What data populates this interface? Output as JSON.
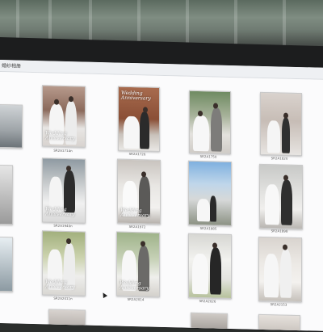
{
  "window": {
    "title": "婚纱相册"
  },
  "files": [
    {
      "name": "SR2A1714n"
    },
    {
      "name": "SR2A1726"
    },
    {
      "name": "SR2A1750"
    },
    {
      "name": "SR2A1820"
    },
    {
      "name": "SR2A1940n"
    },
    {
      "name": "SR2A1972"
    },
    {
      "name": "SR2A1985"
    },
    {
      "name": "SR2A1898"
    },
    {
      "name": "SR2A2011n"
    },
    {
      "name": "SR2A2014"
    },
    {
      "name": "SR2A2026"
    },
    {
      "name": "SR2A2153"
    }
  ],
  "overlay_text": {
    "line1": "Wedding",
    "line2": "Anniversary"
  },
  "colors": {
    "screen_bg": "#fbfbfc",
    "bezel": "#1c1d1e"
  }
}
